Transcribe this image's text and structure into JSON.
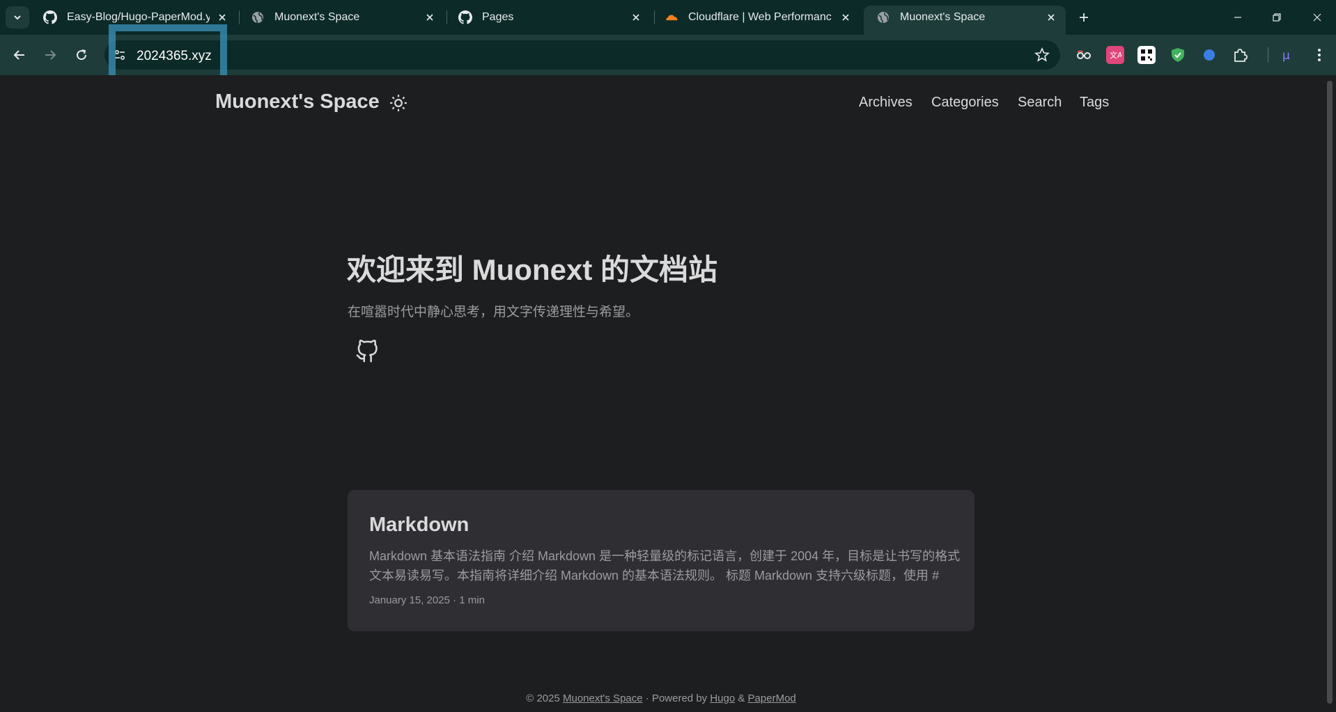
{
  "browser": {
    "tabs": [
      {
        "title": "Easy-Blog/Hugo-PaperMod.y",
        "icon": "github-icon"
      },
      {
        "title": "Muonext's Space",
        "icon": "globe-icon"
      },
      {
        "title": "Pages",
        "icon": "github-icon"
      },
      {
        "title": "Cloudflare | Web Performanc",
        "icon": "cloudflare-icon"
      },
      {
        "title": "Muonext's Space",
        "icon": "globe-icon",
        "active": true
      }
    ],
    "url": "2024365.xyz",
    "accent": "#0c2a28",
    "highlight_color": "#3b8fb6"
  },
  "site": {
    "logo": "Muonext's Space",
    "menu": [
      "Archives",
      "Categories",
      "Search",
      "Tags"
    ]
  },
  "hero": {
    "title": "欢迎来到 Muonext 的文档站",
    "subtitle": "在喧嚣时代中静心思考，用文字传递理性与希望。",
    "social_icon": "github-icon"
  },
  "post": {
    "title": "Markdown",
    "excerpt": "Markdown 基本语法指南 介绍 Markdown 是一种轻量级的标记语言，创建于 2004 年，目标是让书写的格式文本易读易写。本指南将详细介绍 Markdown 的基本语法规则。 标题 Markdown 支持六级标题，使用 # 符...",
    "date": "January 15, 2025",
    "separator": "·",
    "reading_time": "1 min"
  },
  "footer": {
    "copyright": "© 2025",
    "site_link": "Muonext's Space",
    "powered_by": "· Powered by",
    "hugo": "Hugo",
    "amp": "&",
    "papermod": "PaperMod"
  }
}
